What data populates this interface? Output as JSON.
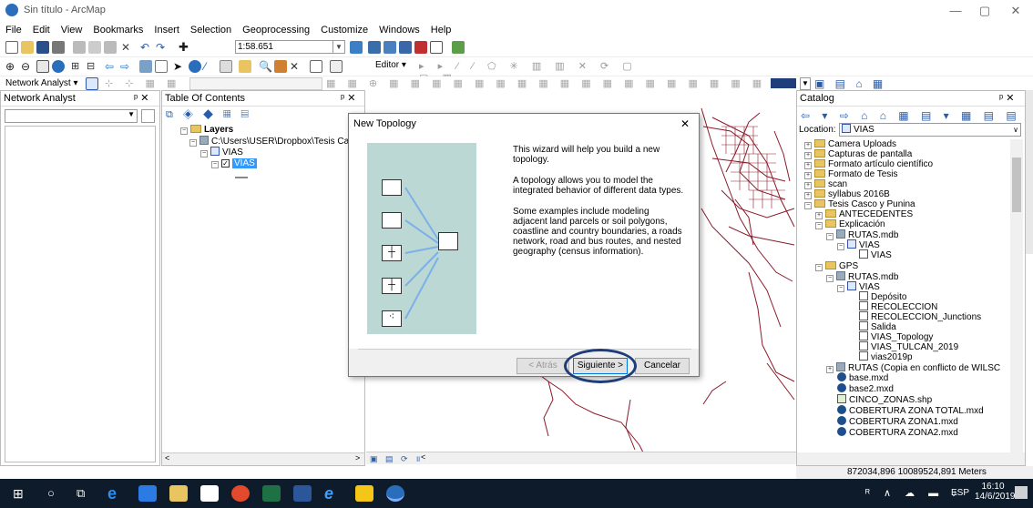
{
  "window": {
    "title": "Sin título - ArcMap",
    "minimize": "—",
    "maximize": "▢",
    "close": "✕"
  },
  "menu": [
    "File",
    "Edit",
    "View",
    "Bookmarks",
    "Insert",
    "Selection",
    "Geoprocessing",
    "Customize",
    "Windows",
    "Help"
  ],
  "toolbar": {
    "scale": "1:58.651",
    "network_analyst": "Network Analyst ▾",
    "editor": "Editor ▾"
  },
  "network_panel": {
    "title": "Network Analyst",
    "pin": "ᵖ ✕"
  },
  "toc": {
    "title": "Table Of Contents",
    "pin": "ᵖ ✕",
    "layers": "Layers",
    "path": "C:\\Users\\USER\\Dropbox\\Tesis Casco",
    "group": "VIAS",
    "layer": "VIAS"
  },
  "dialog": {
    "title": "New Topology",
    "close": "✕",
    "p1": "This wizard will help you build a new topology.",
    "p2": "A topology allows you to model the integrated behavior of different data types.",
    "p3": "Some examples include modeling adjacent land parcels or soil polygons, coastline and country boundaries, a roads network, road and bus routes, and nested geography (census information).",
    "back": "< Atrás",
    "next": "Siguiente >",
    "cancel": "Cancelar"
  },
  "catalog": {
    "title": "Catalog",
    "pin": "ᵖ ✕",
    "location_label": "Location:",
    "location_value": "VIAS",
    "items": [
      "Camera Uploads",
      "Capturas de pantalla",
      "Formato artículo científico",
      "Formato de Tesis",
      "scan",
      "syllabus 2016B",
      "Tesis Casco y Punina",
      "ANTECEDENTES",
      "Explicación",
      "RUTAS.mdb",
      "VIAS",
      "VIAS",
      "GPS",
      "RUTAS.mdb",
      "VIAS",
      "Depósito",
      "RECOLECCION",
      "RECOLECCION_Junctions",
      "Salida",
      "VIAS_Topology",
      "VIAS_TULCAN_2019",
      "vias2019p",
      "RUTAS (Copia en conflicto de WILSC",
      "base.mxd",
      "base2.mxd",
      "CINCO_ZONAS.shp",
      "COBERTURA ZONA TOTAL.mxd",
      "COBERTURA ZONA1.mxd",
      "COBERTURA ZONA2.mxd"
    ]
  },
  "status": {
    "coords": "872034,896  10089524,891 Meters"
  },
  "taskbar": {
    "lang": "ESP",
    "time": "16:10",
    "date": "14/6/2019"
  },
  "colors": {
    "road": "#8b1a2a",
    "accent": "#1f3d7a",
    "selected": "#3399ff"
  }
}
